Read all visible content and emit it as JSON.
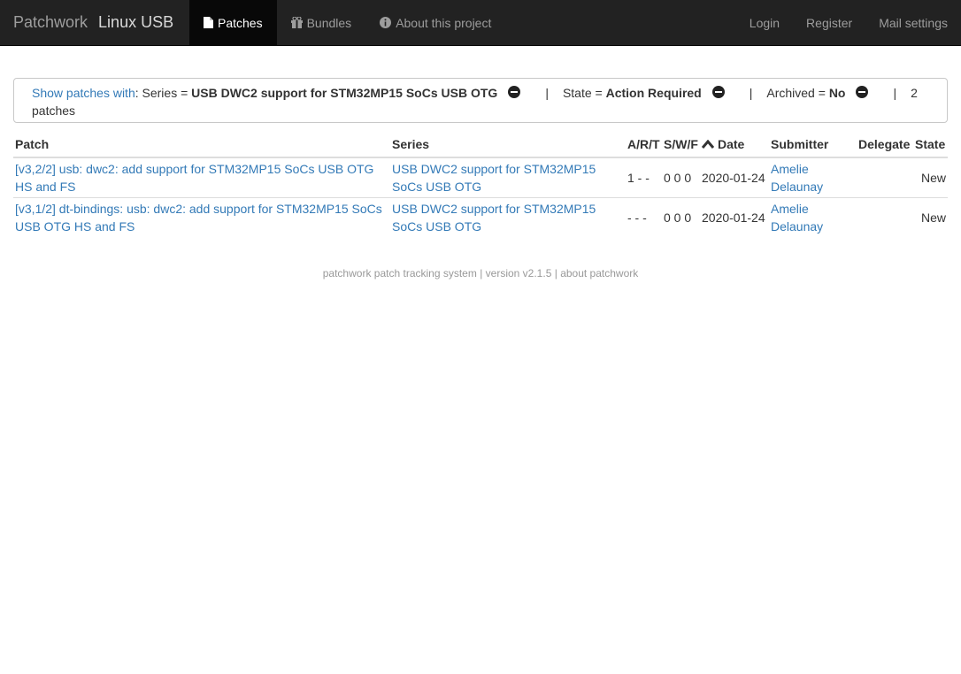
{
  "navbar": {
    "brand": "Patchwork",
    "project": "Linux USB",
    "left": [
      {
        "label": "Patches",
        "icon": "file-icon",
        "active": true
      },
      {
        "label": "Bundles",
        "icon": "gift-icon",
        "active": false
      },
      {
        "label": "About this project",
        "icon": "info-circle-icon",
        "active": false
      }
    ],
    "right": [
      {
        "label": "Login"
      },
      {
        "label": "Register"
      },
      {
        "label": "Mail settings"
      }
    ]
  },
  "filters": {
    "link": "Show patches with",
    "series_label": ": Series =",
    "series_value": "USB DWC2 support for STM32MP15 SoCs USB OTG",
    "separator": "|",
    "state_label": "State =",
    "state_value": "Action Required",
    "archived_label": "Archived =",
    "archived_value": "No",
    "count": "2 patches"
  },
  "table": {
    "headers": {
      "patch": "Patch",
      "series": "Series",
      "art": "A/R/T",
      "swf": "S/W/F",
      "date": "Date",
      "submitter": "Submitter",
      "delegate": "Delegate",
      "state": "State"
    },
    "rows": [
      {
        "patch": "[v3,2/2] usb: dwc2: add support for STM32MP15 SoCs USB OTG HS and FS",
        "series": "USB DWC2 support for STM32MP15 SoCs USB OTG",
        "art": "1 - -",
        "swf": "0 0 0",
        "date": "2020-01-24",
        "submitter": "Amelie Delaunay",
        "delegate": "",
        "state": "New"
      },
      {
        "patch": "[v3,1/2] dt-bindings: usb: dwc2: add support for STM32MP15 SoCs USB OTG HS and FS",
        "series": "USB DWC2 support for STM32MP15 SoCs USB OTG",
        "art": "- - -",
        "swf": "0 0 0",
        "date": "2020-01-24",
        "submitter": "Amelie Delaunay",
        "delegate": "",
        "state": "New"
      }
    ]
  },
  "footer": {
    "link1": "patchwork",
    "text1": "patch tracking system",
    "sep": "|",
    "version": "version v2.1.5",
    "link2": "about patchwork"
  }
}
